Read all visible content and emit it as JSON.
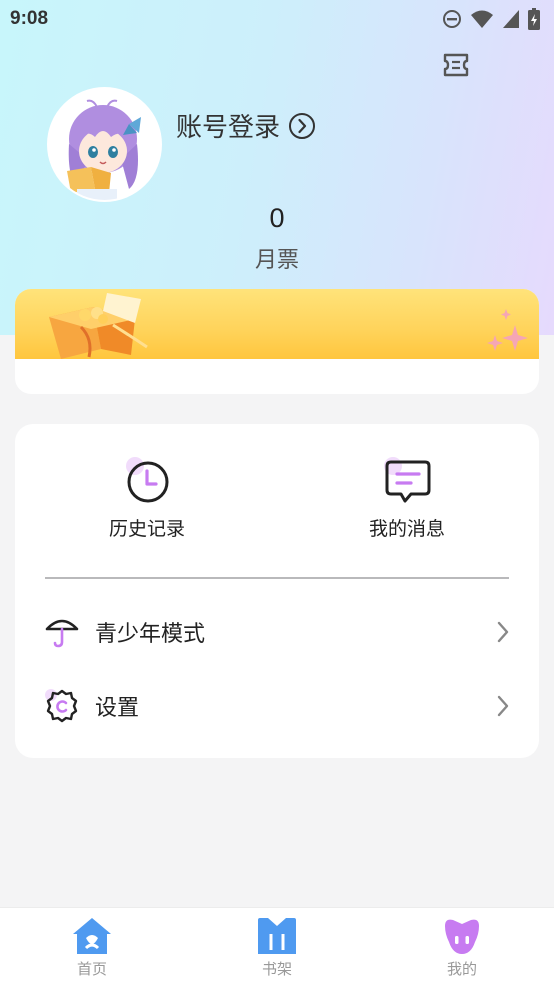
{
  "status_bar": {
    "time": "9:08",
    "icons": [
      "dnd-icon",
      "wifi-icon",
      "signal-icon",
      "battery-icon"
    ]
  },
  "header": {
    "ticket_icon": "ticket-icon",
    "login_label": "账号登录",
    "monthly_ticket_count": "0",
    "monthly_ticket_label": "月票"
  },
  "quick_actions": [
    {
      "label": "历史记录",
      "icon": "history-clock-icon"
    },
    {
      "label": "我的消息",
      "icon": "message-icon"
    }
  ],
  "menu": [
    {
      "label": "青少年模式",
      "icon": "umbrella-icon"
    },
    {
      "label": "设置",
      "icon": "settings-gear-icon"
    }
  ],
  "bottom_nav": [
    {
      "label": "首页",
      "icon": "home-icon"
    },
    {
      "label": "书架",
      "icon": "bookshelf-icon"
    },
    {
      "label": "我的",
      "icon": "mine-icon"
    }
  ],
  "colors": {
    "accent_purple": "#c77bf1",
    "accent_blue": "#4f9af0",
    "banner_yellow": "#ffd35a"
  }
}
